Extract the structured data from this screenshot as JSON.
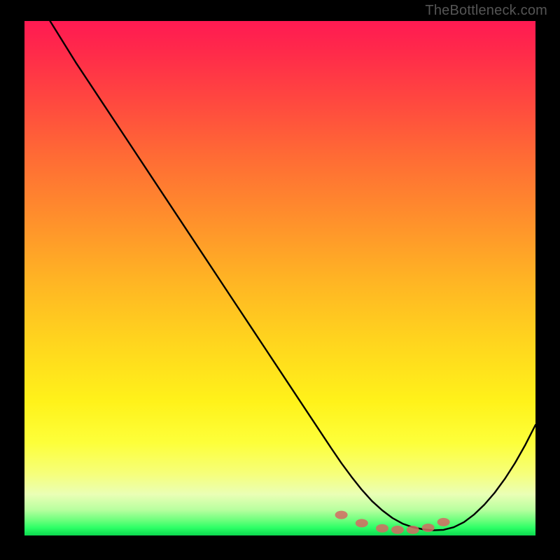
{
  "watermark": "TheBottleneck.com",
  "chart_data": {
    "type": "line",
    "title": "",
    "xlabel": "",
    "ylabel": "",
    "xlim": [
      0,
      100
    ],
    "ylim": [
      0,
      100
    ],
    "grid": false,
    "legend": false,
    "annotations": [],
    "series": [
      {
        "name": "bottleneck-curve",
        "x": [
          5,
          10,
          15,
          20,
          25,
          30,
          35,
          40,
          45,
          50,
          55,
          60,
          62,
          64,
          66,
          68,
          70,
          72,
          74,
          76,
          78,
          80,
          82,
          84,
          86,
          88,
          90,
          92,
          94,
          96,
          98,
          100
        ],
        "values": [
          100,
          92,
          84.5,
          77,
          69.5,
          62,
          54.5,
          47,
          39.5,
          32,
          24.5,
          17,
          14.1,
          11.4,
          8.9,
          6.7,
          4.9,
          3.4,
          2.3,
          1.6,
          1.2,
          1.0,
          1.1,
          1.6,
          2.6,
          4.1,
          6.0,
          8.3,
          11.0,
          14.1,
          17.6,
          21.5
        ]
      }
    ],
    "marker_points": {
      "name": "highlight-dots",
      "color": "#d46a63",
      "x": [
        62,
        66,
        70,
        73,
        76,
        79,
        82
      ],
      "values": [
        4.0,
        2.4,
        1.4,
        1.1,
        1.1,
        1.5,
        2.6
      ]
    },
    "gradient_stops": [
      {
        "pos": 0.0,
        "color": "#ff1a52"
      },
      {
        "pos": 0.15,
        "color": "#ff4640"
      },
      {
        "pos": 0.38,
        "color": "#ff8e2c"
      },
      {
        "pos": 0.62,
        "color": "#ffd41e"
      },
      {
        "pos": 0.82,
        "color": "#fdff3a"
      },
      {
        "pos": 0.95,
        "color": "#b8ff9f"
      },
      {
        "pos": 1.0,
        "color": "#0cd94f"
      }
    ]
  }
}
